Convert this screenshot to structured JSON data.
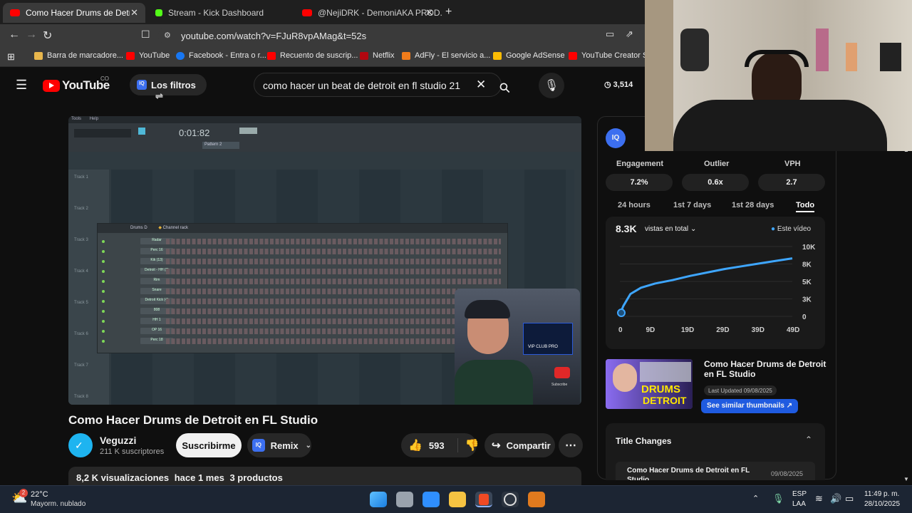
{
  "tabs": [
    {
      "label": "Como Hacer Drums de Detroit e",
      "active": true
    },
    {
      "label": "Stream - Kick Dashboard",
      "active": false
    },
    {
      "label": "@NejiDRK - DemoniAKA PROD.",
      "active": false
    }
  ],
  "address": {
    "url": "youtube.com/watch?v=FJuR8vpAMag&t=52s"
  },
  "bookmarks": [
    "Barra de marcadore...",
    "YouTube",
    "Facebook - Entra o r...",
    "Recuento de suscrip...",
    "Netflix",
    "AdFly - El servicio a...",
    "Google AdSense",
    "YouTube Creator St..."
  ],
  "youtube": {
    "logo": "YouTube",
    "country": "CO",
    "filters_label": "Los filtros",
    "search_value": "como hacer un beat de detroit en fl studio 21",
    "count": "3,514"
  },
  "video": {
    "fl_menu": [
      "Tools",
      "Help"
    ],
    "time": "0:01:82",
    "pattern": "Pattern 2",
    "channel_rack_title": "Channel rack",
    "rack_group": "Drums D",
    "channels": [
      "Radar",
      "Perc 16",
      "Kik (13)",
      "Detroit - HH (3)",
      "Rim",
      "Snare",
      "Detroit Kick (4)",
      "808",
      "HH 1",
      "OP 16",
      "Perc 18"
    ],
    "tracks": [
      "Track 1",
      "Track 2",
      "Track 3",
      "Track 4",
      "Track 5",
      "Track 6",
      "Track 7",
      "Track 8"
    ],
    "pip_badge": "VIP CLUB PRO",
    "pip_sub": "Subscribe",
    "title": "Como Hacer Drums de Detroit en FL Studio"
  },
  "channel": {
    "name": "Veguzzi",
    "subs": "211 K suscriptores",
    "subscribe_label": "Suscribirme",
    "remix_label": "Remix",
    "likes": "593",
    "share_label": "Compartir"
  },
  "description": {
    "views": "8,2 K visualizaciones",
    "age": "hace 1 mes",
    "products": "3 productos"
  },
  "panel": {
    "metrics": [
      {
        "label": "Engagement",
        "value": "7.2%"
      },
      {
        "label": "Outlier",
        "value": "0.6x"
      },
      {
        "label": "VPH",
        "value": "2.7"
      }
    ],
    "ranges": [
      "24 hours",
      "1st 7 days",
      "1st 28 days",
      "Todo"
    ],
    "active_range": "Todo",
    "views_total": "8.3K",
    "views_label": "vistas en total",
    "legend": "Este vídeo",
    "thumb_title": "Como Hacer Drums de Detroit en FL Studio",
    "last_updated": "Last Updated 09/08/2025",
    "similar_label": "See similar thumbnails",
    "thumb_text_1": "DRUMS",
    "thumb_text_2": "DETROIT",
    "title_changes_label": "Title Changes",
    "title_change_item": "Como Hacer Drums de Detroit en FL Studio",
    "title_change_date": "09/08/2025"
  },
  "chart_data": {
    "type": "line",
    "x_tick_labels": [
      "0",
      "9D",
      "19D",
      "29D",
      "39D",
      "49D"
    ],
    "y_tick_labels": [
      "10K",
      "8K",
      "5K",
      "3K",
      "0"
    ],
    "ylim": [
      0,
      10000
    ],
    "series": [
      {
        "name": "Este vídeo",
        "x": [
          0,
          1,
          3,
          6,
          10,
          15,
          20,
          25,
          30,
          35,
          40,
          45,
          49
        ],
        "y": [
          300,
          1500,
          3200,
          4100,
          4700,
          5200,
          5800,
          6300,
          6800,
          7200,
          7600,
          8000,
          8300
        ]
      }
    ],
    "color": "#3ea6ff"
  },
  "taskbar": {
    "temp": "22°C",
    "weather": "Mayorm. nublado",
    "weather_badge": "2",
    "lang": "ESP",
    "layout": "LAA",
    "time": "11:49 p. m.",
    "date": "28/10/2025"
  }
}
